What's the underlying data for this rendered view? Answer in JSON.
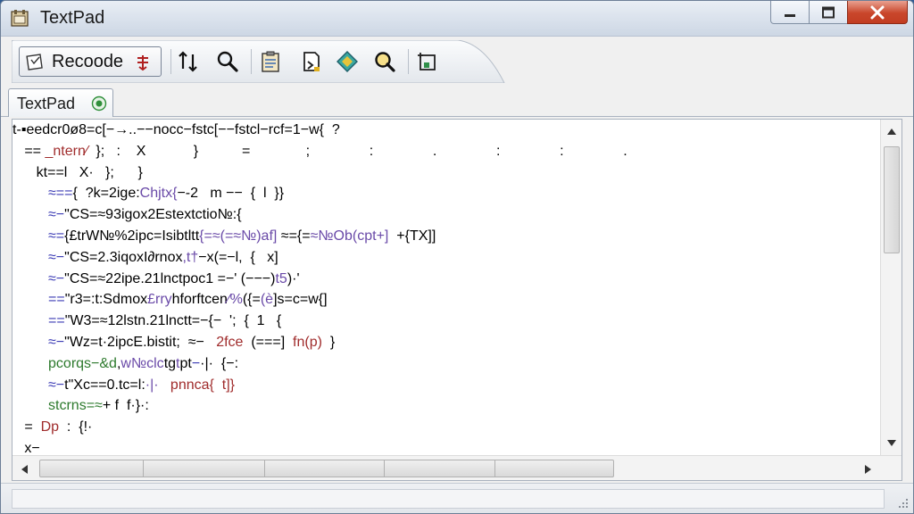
{
  "window": {
    "title": "TextPad"
  },
  "toolbar": {
    "recode_label": "Recoode",
    "icons": [
      "recode-icon",
      "sort-icon",
      "search-icon",
      "clipboard-icon",
      "export-icon",
      "diamond-icon",
      "zoom-icon",
      "frame-icon"
    ]
  },
  "tabs": [
    {
      "label": "TextPad",
      "icon": "tab-status-icon"
    }
  ],
  "editor": {
    "lines": [
      [
        {
          "t": "t-▪eedcr0ø8=c[−→..−−nocc−fstc[−−fstcl−rcf=1−w{  ?",
          "c": ""
        }
      ],
      [
        {
          "t": "   == ",
          "c": ""
        },
        {
          "t": "_ntern∕",
          "c": "tok-red"
        },
        {
          "t": "  };   :    X            }           =              ;               :               .               :               :               .",
          "c": ""
        }
      ],
      [
        {
          "t": "      kt==l   X·   };      }",
          "c": ""
        }
      ],
      [
        {
          "t": "         ",
          "c": ""
        },
        {
          "t": "≈==",
          "c": "tok-blue"
        },
        {
          "t": "{  ?k=2ige:",
          "c": ""
        },
        {
          "t": "Chjtx{",
          "c": "tok-purple"
        },
        {
          "t": "−-2   m −−  {  l  }}",
          "c": ""
        }
      ],
      [
        {
          "t": "         ",
          "c": ""
        },
        {
          "t": "≈−",
          "c": "tok-blue"
        },
        {
          "t": "\"CS=≈93igox2Estextctio№:{",
          "c": ""
        }
      ],
      [
        {
          "t": "         ",
          "c": ""
        },
        {
          "t": "≈=",
          "c": "tok-blue"
        },
        {
          "t": "{£trW№%2ipc=Isibtltt",
          "c": ""
        },
        {
          "t": "{=≈(=≈№)af]",
          "c": "tok-purple"
        },
        {
          "t": " ≈={=",
          "c": ""
        },
        {
          "t": "≈№Ob(cpt+]",
          "c": "tok-purple"
        },
        {
          "t": "  +{TX]]",
          "c": ""
        }
      ],
      [
        {
          "t": "         ",
          "c": ""
        },
        {
          "t": "≈−",
          "c": "tok-blue"
        },
        {
          "t": "\"CS=2.3iqoxI∂rnox",
          "c": ""
        },
        {
          "t": ",t†",
          "c": "tok-purple"
        },
        {
          "t": "−x(=−l,  {   x]",
          "c": ""
        }
      ],
      [
        {
          "t": "         ",
          "c": ""
        },
        {
          "t": "≈−",
          "c": "tok-blue"
        },
        {
          "t": "\"CS=≈22ipe.21lnctpoc1 =−' (−−−)",
          "c": ""
        },
        {
          "t": "t5",
          "c": "tok-purple"
        },
        {
          "t": ")·'",
          "c": ""
        }
      ],
      [
        {
          "t": "         ",
          "c": ""
        },
        {
          "t": "==",
          "c": "tok-blue"
        },
        {
          "t": "\"r3=:t:Sdmox",
          "c": ""
        },
        {
          "t": "£rry",
          "c": "tok-purple"
        },
        {
          "t": "hforftcen",
          "c": ""
        },
        {
          "t": "∕%",
          "c": "tok-purple"
        },
        {
          "t": "({=",
          "c": ""
        },
        {
          "t": "(è",
          "c": "tok-purple"
        },
        {
          "t": "]s=c=w{]",
          "c": ""
        }
      ],
      [
        {
          "t": "         ",
          "c": ""
        },
        {
          "t": "==",
          "c": "tok-blue"
        },
        {
          "t": "\"W3=≈12lstn.21lnctt=−{−  ';  {  1   {",
          "c": ""
        }
      ],
      [
        {
          "t": "         ",
          "c": ""
        },
        {
          "t": "≈−",
          "c": "tok-blue"
        },
        {
          "t": "\"Wz=t·2ipcE.bistit;  ≈−   ",
          "c": ""
        },
        {
          "t": "2fce",
          "c": "tok-red"
        },
        {
          "t": "  (===]  ",
          "c": ""
        },
        {
          "t": "fn(p)",
          "c": "tok-red"
        },
        {
          "t": "  }",
          "c": ""
        }
      ],
      [
        {
          "t": "         ",
          "c": ""
        },
        {
          "t": "pcorqs−&d",
          "c": "tok-green"
        },
        {
          "t": ",",
          "c": ""
        },
        {
          "t": "w№clc",
          "c": "tok-purple"
        },
        {
          "t": "tg",
          "c": ""
        },
        {
          "t": "t",
          "c": "tok-purple"
        },
        {
          "t": "pt",
          "c": ""
        },
        {
          "t": "−",
          "c": "tok-blue"
        },
        {
          "t": "·|·  {−:",
          "c": ""
        }
      ],
      [
        {
          "t": "         ",
          "c": ""
        },
        {
          "t": "≈−",
          "c": "tok-blue"
        },
        {
          "t": "t\"Xc==0.tc=l:",
          "c": ""
        },
        {
          "t": "·|·",
          "c": "tok-purple"
        },
        {
          "t": "   ",
          "c": ""
        },
        {
          "t": "pnnca{",
          "c": "tok-red"
        },
        {
          "t": "  ",
          "c": ""
        },
        {
          "t": "t]}",
          "c": "tok-red"
        }
      ],
      [
        {
          "t": "         ",
          "c": ""
        },
        {
          "t": "stcrns=≈",
          "c": "tok-green"
        },
        {
          "t": "+ f  f·}·:",
          "c": ""
        }
      ],
      [
        {
          "t": "   =  ",
          "c": ""
        },
        {
          "t": "Dp",
          "c": "tok-red"
        },
        {
          "t": "  :  {!·",
          "c": ""
        }
      ],
      [
        {
          "t": "   x−",
          "c": ""
        }
      ]
    ]
  },
  "colors": {
    "title_bar": "#dbe3ee",
    "close_button": "#c9462b",
    "editor_bg": "#ffffff",
    "token_red": "#a02c2c",
    "token_blue": "#3b3bb5",
    "token_green": "#2d7a2d",
    "token_purple": "#6a4aa8"
  }
}
